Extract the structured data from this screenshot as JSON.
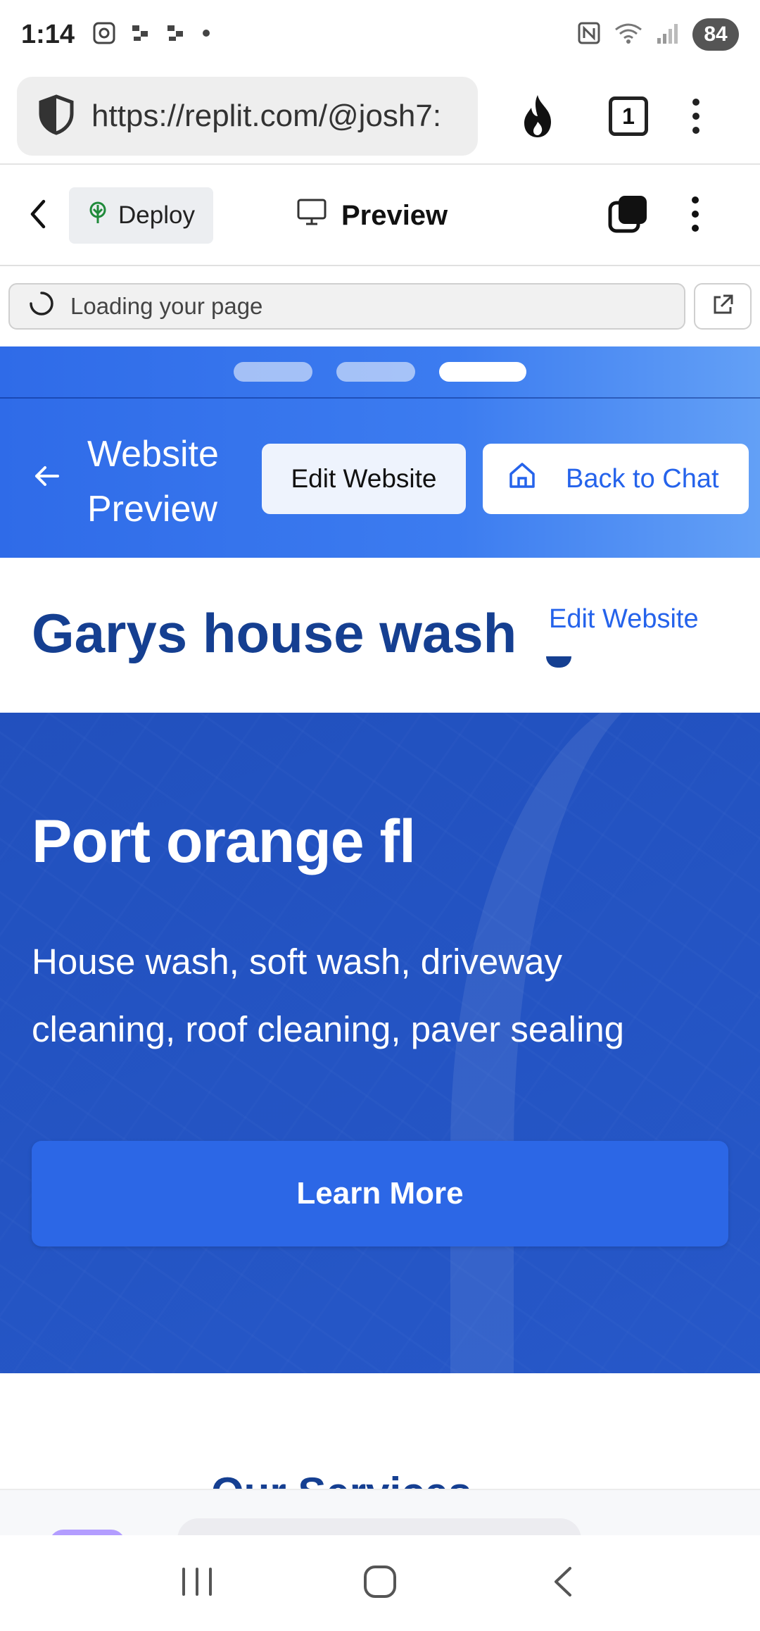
{
  "status_bar": {
    "time": "1:14",
    "battery": "84",
    "wifi_label": "5"
  },
  "browser": {
    "url": "https://replit.com/@josh7:",
    "tab_count": "1"
  },
  "replit": {
    "deploy_label": "Deploy",
    "preview_label": "Preview",
    "loading_text": "Loading your page"
  },
  "preview_header": {
    "title": "Website Preview",
    "edit_button": "Edit Website",
    "back_to_chat": "Back to Chat",
    "accent_color": "#2563eb"
  },
  "site": {
    "title": "Garys house washi",
    "edit_link": "Edit Website",
    "title_color": "#153f91",
    "hero": {
      "heading": "Port orange fl",
      "description": "House wash, soft wash, driveway cleaning, roof cleaning, paver sealing",
      "cta": "Learn More"
    },
    "services_heading_partial": "Our Services"
  },
  "nav": {
    "recent": "recent-apps-icon",
    "home": "home-icon",
    "back": "back-icon"
  }
}
